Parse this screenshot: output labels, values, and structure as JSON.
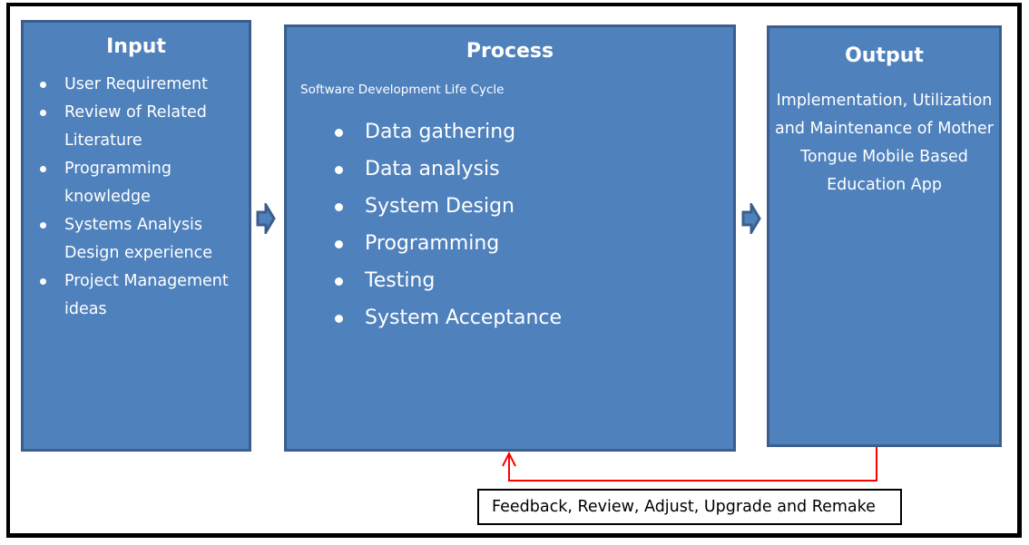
{
  "diagram": {
    "input": {
      "title": "Input",
      "items": [
        "User Requirement",
        "Review of Related Literature",
        "Programming knowledge",
        "Systems Analysis Design experience",
        "Project Management ideas"
      ]
    },
    "process": {
      "title": "Process",
      "subtitle": "Software Development  Life Cycle",
      "items": [
        "Data gathering",
        "Data analysis",
        "System Design",
        "Programming",
        "Testing",
        "System Acceptance"
      ]
    },
    "output": {
      "title": "Output",
      "body": "Implementation, Utilization and Maintenance of Mother Tongue Mobile Based Education App"
    },
    "feedback": {
      "label": "Feedback, Review, Adjust, Upgrade and Remake"
    },
    "colors": {
      "box_fill": "#4f81bd",
      "box_border": "#3b5e8c",
      "feedback_line": "#ff0000"
    }
  }
}
